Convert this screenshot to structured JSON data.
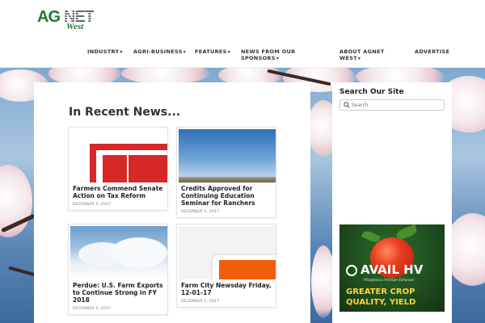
{
  "logo": {
    "ag": "AG",
    "net": "NET",
    "west": "West"
  },
  "nav": [
    {
      "label": "INDUSTRY",
      "chevron": "▾"
    },
    {
      "label": "AGRI-BUSINESS",
      "chevron": "▾"
    },
    {
      "label": "FEATURES",
      "chevron": "▾"
    },
    {
      "label": "NEWS FROM OUR",
      "label2": "SPONSORS",
      "chevron": "▾"
    },
    {
      "label": "ABOUT AGNET",
      "label2": "WEST",
      "chevron": "▾"
    },
    {
      "label": "ADVERTISE"
    }
  ],
  "main": {
    "section_title": "In Recent News...",
    "posts": [
      {
        "title": "Farmers Commend Senate Action on Tax Reform",
        "date": "DECEMBER 5, 2017",
        "thumb": "red-document-graphic"
      },
      {
        "title": "Credits Approved for Continuing Education Seminar for Ranchers",
        "date": "DECEMBER 1, 2017",
        "thumb": "blue-sky-field"
      },
      {
        "title": "Perdue: U.S. Farm Exports to Continue Strong in FY 2018",
        "date": "DECEMBER 1, 2017",
        "thumb": "clouds-sky"
      },
      {
        "title": "Farm City Newsday Friday, 12-01-17",
        "date": "DECEMBER 1, 2017",
        "thumb": "orange-screen-graphic"
      }
    ]
  },
  "sidebar": {
    "title": "Search Our Site",
    "search_placeholder": "Search",
    "search_icon": "search-icon",
    "ad": {
      "brand": "AVAIL HV",
      "subtitle": "Phosphorus Fertilizer Enhancer",
      "line1": "GREATER CROP",
      "line2": "QUALITY, YIELD"
    }
  },
  "colors": {
    "logo_green": "#1f7a2e",
    "ad_yellow": "#ffd33a",
    "sky_blue": "#5a86b6"
  }
}
